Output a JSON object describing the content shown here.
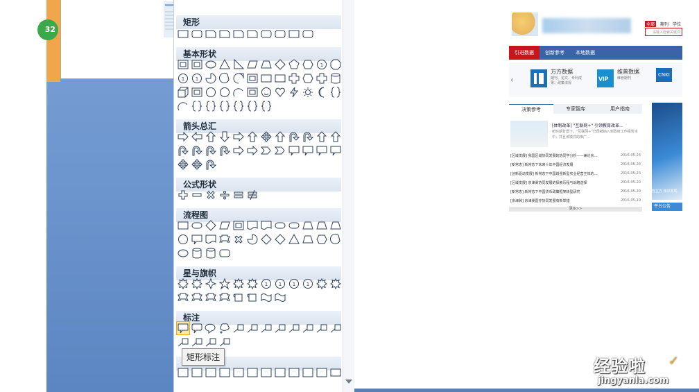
{
  "left_doc": {
    "badge_text": "32"
  },
  "shapes_panel": {
    "sections": [
      {
        "key": "rectangles",
        "label": "矩形"
      },
      {
        "key": "basic",
        "label": "基本形状"
      },
      {
        "key": "arrows",
        "label": "箭头总汇"
      },
      {
        "key": "equation",
        "label": "公式形状"
      },
      {
        "key": "flowchart",
        "label": "流程图"
      },
      {
        "key": "stars",
        "label": "星与旗帜"
      },
      {
        "key": "callouts",
        "label": "标注"
      }
    ],
    "tooltip": "矩形标注"
  },
  "webpage": {
    "search_tabs": [
      "全部",
      "期刊",
      "学位"
    ],
    "search_placeholder": "请输入检索关键词",
    "nav": [
      "引进数据",
      "创新参考",
      "本地数据"
    ],
    "databases": [
      {
        "name": "万方数据",
        "desc": "期刊、论文、专利成果、政策法规"
      },
      {
        "name": "维普数据",
        "desc": "维普期刊"
      },
      {
        "name": "CNKI",
        "desc": ""
      }
    ],
    "tabs": [
      "决策参考",
      "专家智库",
      "用户指南"
    ],
    "feature": {
      "title": "[体制改革] \"互联网+\" 引领教育改革...",
      "text": "新时期背景下，\"互联网+\"已经被纳入到政府工作报告当中，并且该模式的推广..."
    },
    "news": [
      {
        "title": "[区域发展] 我国区域协同发展的协同学分析——兼论京...",
        "date": "2016-05-24"
      },
      {
        "title": "[新常态] 新常态下未来十年中国经济发展",
        "date": "2016-05-24"
      },
      {
        "title": "[创新驱动发展] 新常态下中国增强新型农业经营主体的...",
        "date": "2016-05-23"
      },
      {
        "title": "[区域发展] 京津冀协同发展的探索历程与战略选择",
        "date": "2016-05-20"
      },
      {
        "title": "[新常态] 新常态下中国货币政策框架转型研究",
        "date": "2016-05-20"
      },
      {
        "title": "[京津冀] 京津冀医疗协同发展有新举措",
        "date": "2016-05-19"
      }
    ],
    "more": "更多>>",
    "side_caption": "智立方 知识发现",
    "notice": "平台公告"
  },
  "watermark": {
    "main": "经验啦",
    "sub": "jingyanla.com"
  },
  "colors": {
    "nav_blue": "#3a63a8",
    "active_red": "#c8161d",
    "doc_blue": "#6f97cf"
  }
}
